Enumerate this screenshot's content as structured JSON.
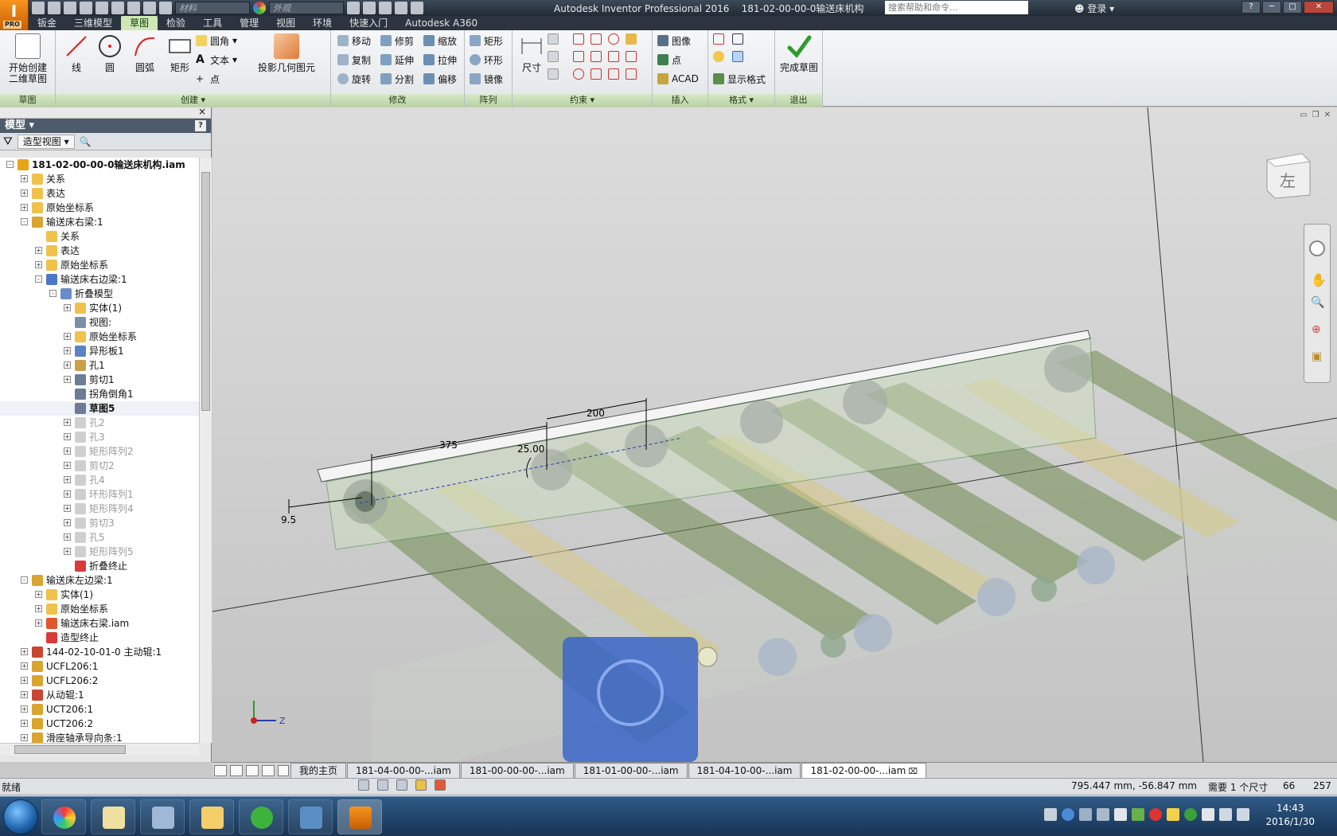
{
  "title_bar": {
    "app_title": "Autodesk Inventor Professional 2016",
    "document": "181-02-00-00-0输送床机构",
    "material_combo": "材料",
    "appearance_combo": "外观",
    "help_search_placeholder": "搜索帮助和命令...",
    "login_label": "登录",
    "app_badge": "PRO"
  },
  "menu_tabs": [
    {
      "label": "钣金"
    },
    {
      "label": "三维模型"
    },
    {
      "label": "草图",
      "active": true
    },
    {
      "label": "检验"
    },
    {
      "label": "工具"
    },
    {
      "label": "管理"
    },
    {
      "label": "视图"
    },
    {
      "label": "环境"
    },
    {
      "label": "快速入门"
    },
    {
      "label": "Autodesk A360"
    }
  ],
  "ribbon": {
    "sketch_panel": {
      "title": "草图",
      "start_sketch": "开始创建\n二维草图"
    },
    "create_panel": {
      "title": "创建",
      "line": "线",
      "circle": "圆",
      "arc": "圆弧",
      "rect": "矩形",
      "fillet": "圆角",
      "text": "文本",
      "point": "点",
      "project": "投影几何图元"
    },
    "modify_panel": {
      "title": "修改",
      "move": "移动",
      "trim": "修剪",
      "scale": "缩放",
      "copy": "复制",
      "extend": "延伸",
      "stretch": "拉伸",
      "rotate": "旋转",
      "split": "分割",
      "offset": "偏移"
    },
    "pattern_panel": {
      "title": "阵列",
      "rect": "矩形",
      "circ": "环形",
      "mirror": "镜像"
    },
    "constrain_panel": {
      "title": "约束",
      "dimension": "尺寸"
    },
    "insert_panel": {
      "title": "插入",
      "image": "图像",
      "points": "点",
      "acad": "ACAD"
    },
    "format_panel": {
      "title": "格式",
      "show_format": "显示格式"
    },
    "exit_panel": {
      "title": "退出",
      "finish": "完成草图"
    }
  },
  "browser": {
    "title": "模型",
    "view_combo": "造型视图",
    "tree": [
      {
        "label": "181-02-00-00-0输送床机构.iam",
        "level": 0,
        "exp": "-",
        "icon": "#e8a317",
        "bold": true
      },
      {
        "label": "关系",
        "level": 1,
        "exp": "+",
        "icon": "#f0c24c"
      },
      {
        "label": "表达",
        "level": 1,
        "exp": "+",
        "icon": "#f0c24c"
      },
      {
        "label": "原始坐标系",
        "level": 1,
        "exp": "+",
        "icon": "#f0c24c"
      },
      {
        "label": "输送床右梁:1",
        "level": 1,
        "exp": "-",
        "icon": "#d9a530"
      },
      {
        "label": "关系",
        "level": 2,
        "exp": "",
        "icon": "#f0c24c"
      },
      {
        "label": "表达",
        "level": 2,
        "exp": "+",
        "icon": "#f0c24c"
      },
      {
        "label": "原始坐标系",
        "level": 2,
        "exp": "+",
        "icon": "#f0c24c"
      },
      {
        "label": "输送床右边梁:1",
        "level": 2,
        "exp": "-",
        "icon": "#4f77c8"
      },
      {
        "label": "折叠模型",
        "level": 3,
        "exp": "-",
        "icon": "#6a8cc9"
      },
      {
        "label": "实体(1)",
        "level": 4,
        "exp": "+",
        "icon": "#f0c24c"
      },
      {
        "label": "视图:",
        "level": 4,
        "exp": "",
        "icon": "#7d8ea8"
      },
      {
        "label": "原始坐标系",
        "level": 4,
        "exp": "+",
        "icon": "#f0c24c"
      },
      {
        "label": "异形板1",
        "level": 4,
        "exp": "+",
        "icon": "#5b83c4"
      },
      {
        "label": "孔1",
        "level": 4,
        "exp": "+",
        "icon": "#c9a14a"
      },
      {
        "label": "剪切1",
        "level": 4,
        "exp": "+",
        "icon": "#6c7c96"
      },
      {
        "label": "拐角倒角1",
        "level": 4,
        "exp": "",
        "icon": "#6c7c96"
      },
      {
        "label": "草图5",
        "level": 4,
        "exp": "",
        "icon": "#6c7c96",
        "sel": true
      },
      {
        "label": "孔2",
        "level": 4,
        "exp": "+",
        "icon": "#cfcfcf",
        "dim": true
      },
      {
        "label": "孔3",
        "level": 4,
        "exp": "+",
        "icon": "#cfcfcf",
        "dim": true
      },
      {
        "label": "矩形阵列2",
        "level": 4,
        "exp": "+",
        "icon": "#cfcfcf",
        "dim": true
      },
      {
        "label": "剪切2",
        "level": 4,
        "exp": "+",
        "icon": "#cfcfcf",
        "dim": true
      },
      {
        "label": "孔4",
        "level": 4,
        "exp": "+",
        "icon": "#cfcfcf",
        "dim": true
      },
      {
        "label": "环形阵列1",
        "level": 4,
        "exp": "+",
        "icon": "#cfcfcf",
        "dim": true
      },
      {
        "label": "矩形阵列4",
        "level": 4,
        "exp": "+",
        "icon": "#cfcfcf",
        "dim": true
      },
      {
        "label": "剪切3",
        "level": 4,
        "exp": "+",
        "icon": "#cfcfcf",
        "dim": true
      },
      {
        "label": "孔5",
        "level": 4,
        "exp": "+",
        "icon": "#cfcfcf",
        "dim": true
      },
      {
        "label": "矩形阵列5",
        "level": 4,
        "exp": "+",
        "icon": "#cfcfcf",
        "dim": true
      },
      {
        "label": "折叠终止",
        "level": 4,
        "exp": "",
        "icon": "#d93a3a"
      },
      {
        "label": "输送床左边梁:1",
        "level": 1,
        "exp": "-",
        "icon": "#d9a530"
      },
      {
        "label": "实体(1)",
        "level": 2,
        "exp": "+",
        "icon": "#f0c24c"
      },
      {
        "label": "原始坐标系",
        "level": 2,
        "exp": "+",
        "icon": "#f0c24c"
      },
      {
        "label": "输送床右梁.iam",
        "level": 2,
        "exp": "+",
        "icon": "#e0572b"
      },
      {
        "label": "造型终止",
        "level": 2,
        "exp": "",
        "icon": "#d93a3a"
      },
      {
        "label": "144-02-10-01-0  主动辊:1",
        "level": 1,
        "exp": "+",
        "icon": "#c8462f"
      },
      {
        "label": "UCFL206:1",
        "level": 1,
        "exp": "+",
        "icon": "#d9a530"
      },
      {
        "label": "UCFL206:2",
        "level": 1,
        "exp": "+",
        "icon": "#d9a530"
      },
      {
        "label": "从动辊:1",
        "level": 1,
        "exp": "+",
        "icon": "#c8462f"
      },
      {
        "label": "UCT206:1",
        "level": 1,
        "exp": "+",
        "icon": "#d9a530"
      },
      {
        "label": "UCT206:2",
        "level": 1,
        "exp": "+",
        "icon": "#d9a530"
      },
      {
        "label": "滑座轴承导向条:1",
        "level": 1,
        "exp": "+",
        "icon": "#d9a530"
      }
    ]
  },
  "viewport": {
    "viewcube_label": "左",
    "dimensions": {
      "d375": "375",
      "d200": "200",
      "d25": "25.00",
      "d95": "9.5"
    },
    "axis_z": "Z"
  },
  "doc_tabs": [
    {
      "label": "我的主页"
    },
    {
      "label": "181-04-00-00-...iam"
    },
    {
      "label": "181-00-00-00-...iam"
    },
    {
      "label": "181-01-00-00-...iam"
    },
    {
      "label": "181-04-10-00-...iam"
    },
    {
      "label": "181-02-00-00-...iam",
      "active": true
    }
  ],
  "status_bar": {
    "ready": "就绪",
    "coords": "795.447 mm, -56.847 mm",
    "need_dims": "需要 1 个尺寸",
    "count_a": "66",
    "count_b": "257"
  },
  "taskbar": {
    "time": "14:43",
    "date": "2016/1/30"
  }
}
